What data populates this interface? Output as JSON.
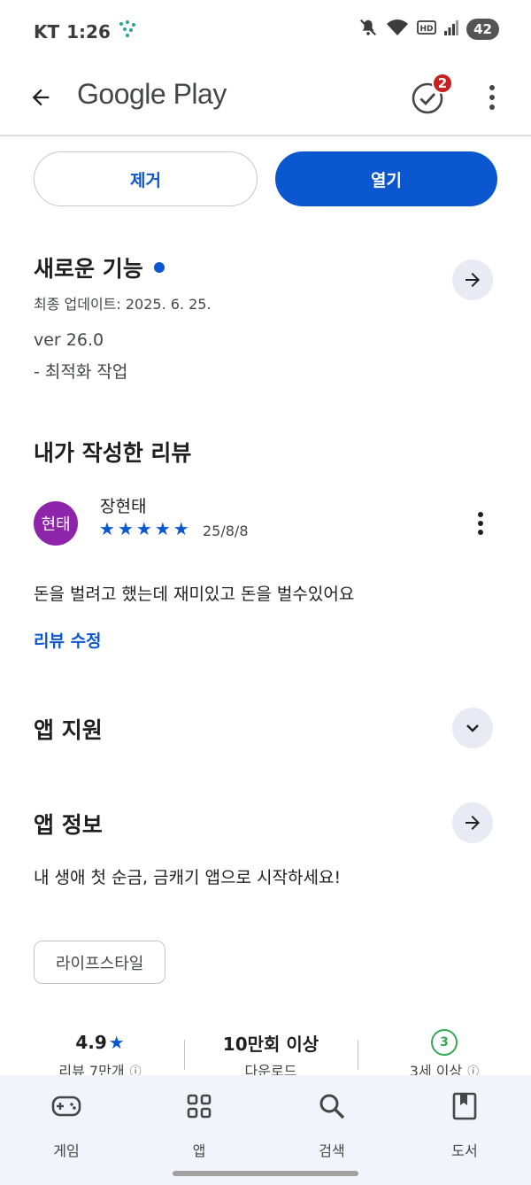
{
  "status_bar": {
    "carrier": "KT",
    "time": "1:26",
    "battery": "42"
  },
  "app_bar": {
    "title": "Google Play",
    "updates_badge": "2"
  },
  "actions": {
    "remove_label": "제거",
    "open_label": "열기"
  },
  "whats_new": {
    "title": "새로운 기능",
    "last_updated": "최종 업데이트: 2025. 6. 25.",
    "version": "ver 26.0",
    "notes": "- 최적화 작업"
  },
  "my_review": {
    "title": "내가 작성한 리뷰",
    "avatar_text": "현태",
    "reviewer_name": "장현태",
    "rating_stars": 5,
    "date": "25/8/8",
    "text": "돈을 벌려고 했는데 재미있고 돈을 벌수있어요",
    "edit_link": "리뷰 수정"
  },
  "app_support": {
    "title": "앱 지원"
  },
  "app_info": {
    "title": "앱 정보",
    "description": "내 생애 첫 순금, 금캐기 앱으로 시작하세요!",
    "category_chip": "라이프스타일"
  },
  "stats": {
    "rating": {
      "value": "4.9",
      "label": "리뷰 7만개"
    },
    "downloads": {
      "value": "10만회 이상",
      "label": "다운로드"
    },
    "age": {
      "value": "3",
      "label": "3세 이상"
    }
  },
  "bottom_nav": {
    "items": [
      {
        "label": "게임"
      },
      {
        "label": "앱"
      },
      {
        "label": "검색"
      },
      {
        "label": "도서"
      }
    ]
  },
  "colors": {
    "accent": "#0b57d0",
    "avatar": "#8e24aa",
    "badge": "#c5221f",
    "age_rating": "#34a853",
    "nav_bg": "#f1f4fa"
  }
}
